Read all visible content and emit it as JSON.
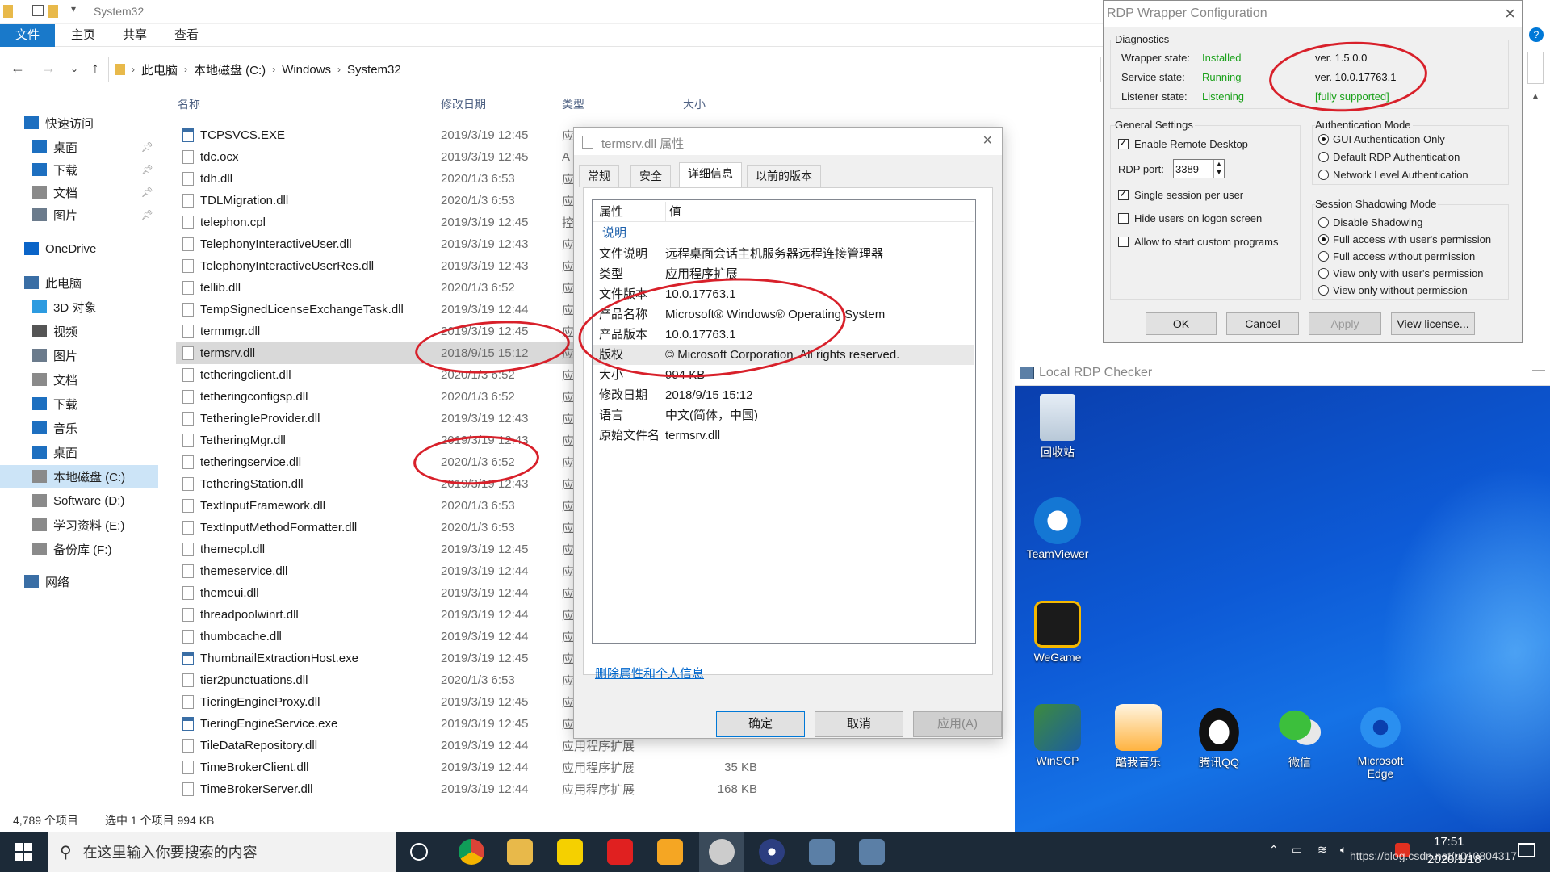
{
  "explorer": {
    "window_title": "System32",
    "ribbon_tabs": [
      "文件",
      "主页",
      "共享",
      "查看"
    ],
    "breadcrumb": [
      "此电脑",
      "本地磁盘 (C:)",
      "Windows",
      "System32"
    ],
    "sidebar": [
      {
        "label": "快速访问",
        "icon": "star-icon"
      },
      {
        "label": "桌面",
        "icon": "desktop-icon"
      },
      {
        "label": "下载",
        "icon": "download-icon"
      },
      {
        "label": "文档",
        "icon": "document-icon"
      },
      {
        "label": "图片",
        "icon": "picture-icon"
      },
      {
        "label": "OneDrive",
        "icon": "cloud-icon"
      },
      {
        "label": "此电脑",
        "icon": "computer-icon"
      },
      {
        "label": "3D 对象",
        "icon": "3d-icon"
      },
      {
        "label": "视频",
        "icon": "video-icon"
      },
      {
        "label": "图片",
        "icon": "picture-icon"
      },
      {
        "label": "文档",
        "icon": "document-icon"
      },
      {
        "label": "下载",
        "icon": "download-icon"
      },
      {
        "label": "音乐",
        "icon": "music-icon"
      },
      {
        "label": "桌面",
        "icon": "desktop-icon"
      },
      {
        "label": "本地磁盘 (C:)",
        "icon": "drive-icon"
      },
      {
        "label": "Software (D:)",
        "icon": "drive-icon"
      },
      {
        "label": "学习资料 (E:)",
        "icon": "drive-icon"
      },
      {
        "label": "备份库 (F:)",
        "icon": "drive-icon"
      },
      {
        "label": "网络",
        "icon": "network-icon"
      }
    ],
    "columns": {
      "name": "名称",
      "date": "修改日期",
      "type": "类型",
      "size": "大小"
    },
    "files": [
      {
        "name": "TCPSVCS.EXE",
        "date": "2019/3/19 12:45",
        "type": "应",
        "size": "",
        "exe": true
      },
      {
        "name": "tdc.ocx",
        "date": "2019/3/19 12:45",
        "type": "A",
        "size": ""
      },
      {
        "name": "tdh.dll",
        "date": "2020/1/3 6:53",
        "type": "应",
        "size": ""
      },
      {
        "name": "TDLMigration.dll",
        "date": "2020/1/3 6:53",
        "type": "应",
        "size": ""
      },
      {
        "name": "telephon.cpl",
        "date": "2019/3/19 12:45",
        "type": "控",
        "size": ""
      },
      {
        "name": "TelephonyInteractiveUser.dll",
        "date": "2019/3/19 12:43",
        "type": "应",
        "size": ""
      },
      {
        "name": "TelephonyInteractiveUserRes.dll",
        "date": "2019/3/19 12:43",
        "type": "应",
        "size": ""
      },
      {
        "name": "tellib.dll",
        "date": "2020/1/3 6:52",
        "type": "应",
        "size": ""
      },
      {
        "name": "TempSignedLicenseExchangeTask.dll",
        "date": "2019/3/19 12:44",
        "type": "应",
        "size": ""
      },
      {
        "name": "termmgr.dll",
        "date": "2019/3/19 12:45",
        "type": "应",
        "size": ""
      },
      {
        "name": "termsrv.dll",
        "date": "2018/9/15 15:12",
        "type": "应",
        "size": "",
        "selected": true
      },
      {
        "name": "tetheringclient.dll",
        "date": "2020/1/3 6:52",
        "type": "应",
        "size": ""
      },
      {
        "name": "tetheringconfigsp.dll",
        "date": "2020/1/3 6:52",
        "type": "应",
        "size": ""
      },
      {
        "name": "TetheringIeProvider.dll",
        "date": "2019/3/19 12:43",
        "type": "应",
        "size": ""
      },
      {
        "name": "TetheringMgr.dll",
        "date": "2019/3/19 12:43",
        "type": "应",
        "size": ""
      },
      {
        "name": "tetheringservice.dll",
        "date": "2020/1/3 6:52",
        "type": "应",
        "size": ""
      },
      {
        "name": "TetheringStation.dll",
        "date": "2019/3/19 12:43",
        "type": "应",
        "size": ""
      },
      {
        "name": "TextInputFramework.dll",
        "date": "2020/1/3 6:53",
        "type": "应",
        "size": ""
      },
      {
        "name": "TextInputMethodFormatter.dll",
        "date": "2020/1/3 6:53",
        "type": "应",
        "size": ""
      },
      {
        "name": "themecpl.dll",
        "date": "2019/3/19 12:45",
        "type": "应",
        "size": ""
      },
      {
        "name": "themeservice.dll",
        "date": "2019/3/19 12:44",
        "type": "应",
        "size": ""
      },
      {
        "name": "themeui.dll",
        "date": "2019/3/19 12:44",
        "type": "应",
        "size": ""
      },
      {
        "name": "threadpoolwinrt.dll",
        "date": "2019/3/19 12:44",
        "type": "应",
        "size": ""
      },
      {
        "name": "thumbcache.dll",
        "date": "2019/3/19 12:44",
        "type": "应",
        "size": ""
      },
      {
        "name": "ThumbnailExtractionHost.exe",
        "date": "2019/3/19 12:45",
        "type": "应",
        "size": "",
        "exe": true
      },
      {
        "name": "tier2punctuations.dll",
        "date": "2020/1/3 6:53",
        "type": "应",
        "size": ""
      },
      {
        "name": "TieringEngineProxy.dll",
        "date": "2019/3/19 12:45",
        "type": "应",
        "size": ""
      },
      {
        "name": "TieringEngineService.exe",
        "date": "2019/3/19 12:45",
        "type": "应",
        "size": "",
        "exe": true
      },
      {
        "name": "TileDataRepository.dll",
        "date": "2019/3/19 12:44",
        "type": "应用程序扩展",
        "size": ""
      },
      {
        "name": "TimeBrokerClient.dll",
        "date": "2019/3/19 12:44",
        "type": "应用程序扩展",
        "size": "35 KB"
      },
      {
        "name": "TimeBrokerServer.dll",
        "date": "2019/3/19 12:44",
        "type": "应用程序扩展",
        "size": "168 KB"
      }
    ],
    "status_count": "4,789 个项目",
    "status_selected": "选中 1 个项目  994 KB"
  },
  "props": {
    "title": "termsrv.dll 属性",
    "tabs": [
      "常规",
      "安全",
      "详细信息",
      "以前的版本"
    ],
    "header_key": "属性",
    "header_val": "值",
    "group": "说明",
    "rows": [
      {
        "k": "文件说明",
        "v": "远程桌面会话主机服务器远程连接管理器"
      },
      {
        "k": "类型",
        "v": "应用程序扩展"
      },
      {
        "k": "文件版本",
        "v": "10.0.17763.1"
      },
      {
        "k": "产品名称",
        "v": "Microsoft® Windows® Operating System"
      },
      {
        "k": "产品版本",
        "v": "10.0.17763.1"
      },
      {
        "k": "版权",
        "v": "© Microsoft Corporation. All rights reserved."
      },
      {
        "k": "大小",
        "v": "994 KB"
      },
      {
        "k": "修改日期",
        "v": "2018/9/15 15:12"
      },
      {
        "k": "语言",
        "v": "中文(简体，中国)"
      },
      {
        "k": "原始文件名",
        "v": "termsrv.dll"
      }
    ],
    "remove_link": "删除属性和个人信息",
    "ok": "确定",
    "cancel": "取消",
    "apply": "应用(A)"
  },
  "rdpw": {
    "title": "RDP Wrapper Configuration",
    "diagnostics": "Diagnostics",
    "wrapper_label": "Wrapper state:",
    "wrapper_val": "Installed",
    "wrapper_ver": "ver.  1.5.0.0",
    "service_label": "Service state:",
    "service_val": "Running",
    "service_ver": "ver.  10.0.17763.1",
    "listener_label": "Listener state:",
    "listener_val": "Listening",
    "support": "[fully supported]",
    "general": "General Settings",
    "enable_rd": "Enable Remote Desktop",
    "rdp_port_label": "RDP port:",
    "rdp_port": "3389",
    "single_session": "Single session per user",
    "hide_users": "Hide users on logon screen",
    "custom_programs": "Allow to start custom programs",
    "auth_mode": "Authentication Mode",
    "auth_opts": [
      "GUI Authentication Only",
      "Default RDP Authentication",
      "Network Level Authentication"
    ],
    "shadow_mode": "Session Shadowing Mode",
    "shadow_opts": [
      "Disable Shadowing",
      "Full access with user's permission",
      "Full access without permission",
      "View only with user's permission",
      "View only without permission"
    ],
    "ok": "OK",
    "cancel": "Cancel",
    "apply": "Apply",
    "license": "View license..."
  },
  "checker": {
    "title": "Local RDP Checker",
    "icons": [
      "回收站",
      "TeamViewer",
      "WeGame",
      "WinSCP",
      "酷我音乐",
      "腾讯QQ",
      "微信",
      "Microsoft Edge"
    ]
  },
  "taskbar": {
    "search_placeholder": "在这里输入你要搜索的内容",
    "time": "17:51",
    "date": "2020/1/18",
    "watermark": "https://blog.csdn.net/u010804317"
  }
}
